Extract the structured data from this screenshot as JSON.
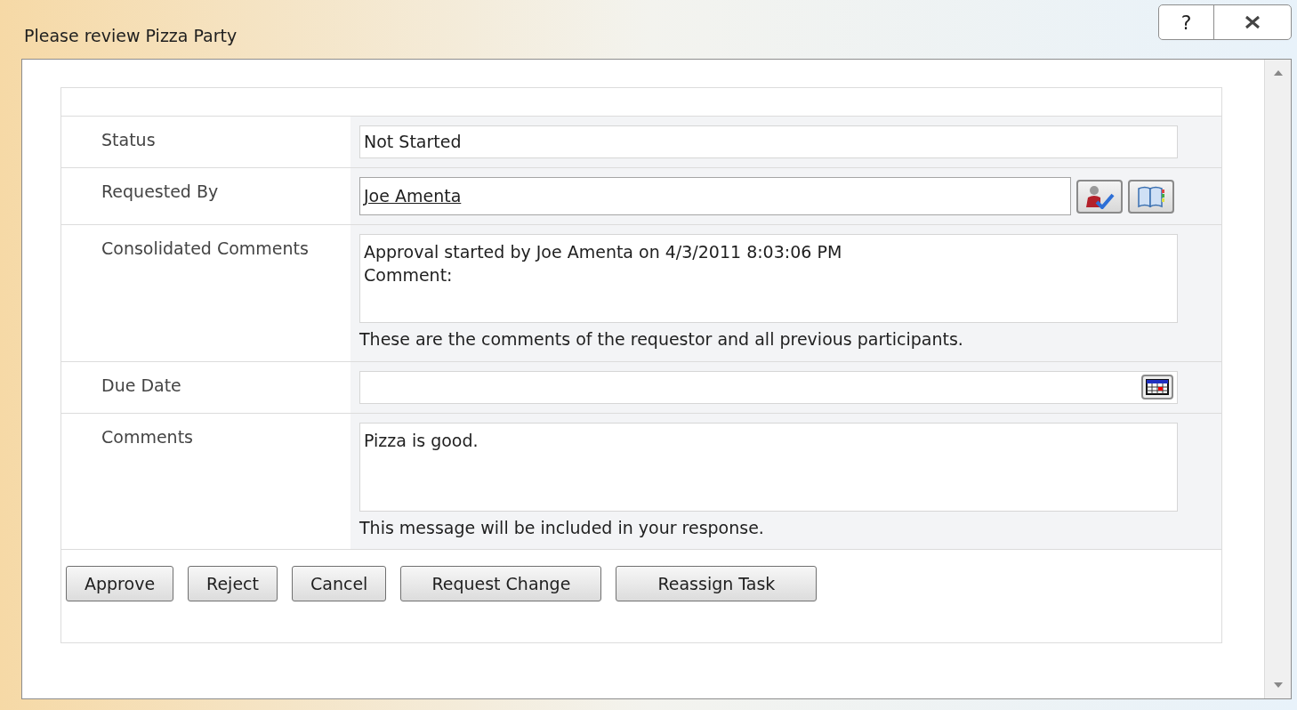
{
  "window": {
    "title": "Please review Pizza Party",
    "help_button": "?"
  },
  "form": {
    "rows": [
      {
        "kind": "text",
        "label": "Status",
        "value": "Not Started"
      },
      {
        "kind": "people",
        "label": "Requested By",
        "value": "Joe Amenta"
      },
      {
        "kind": "multiline",
        "label": "Consolidated Comments",
        "lines": [
          "Approval started by Joe Amenta on 4/3/2011 8:03:06 PM",
          "Comment:"
        ],
        "hint": "These are the comments of the requestor and all previous participants."
      },
      {
        "kind": "date",
        "label": "Due Date"
      },
      {
        "kind": "multiline",
        "label": "Comments",
        "lines": [
          "Pizza is good."
        ],
        "hint": "This message will be included in your response."
      }
    ]
  },
  "buttons": [
    "Approve",
    "Reject",
    "Cancel",
    "Request Change",
    "Reassign Task"
  ]
}
